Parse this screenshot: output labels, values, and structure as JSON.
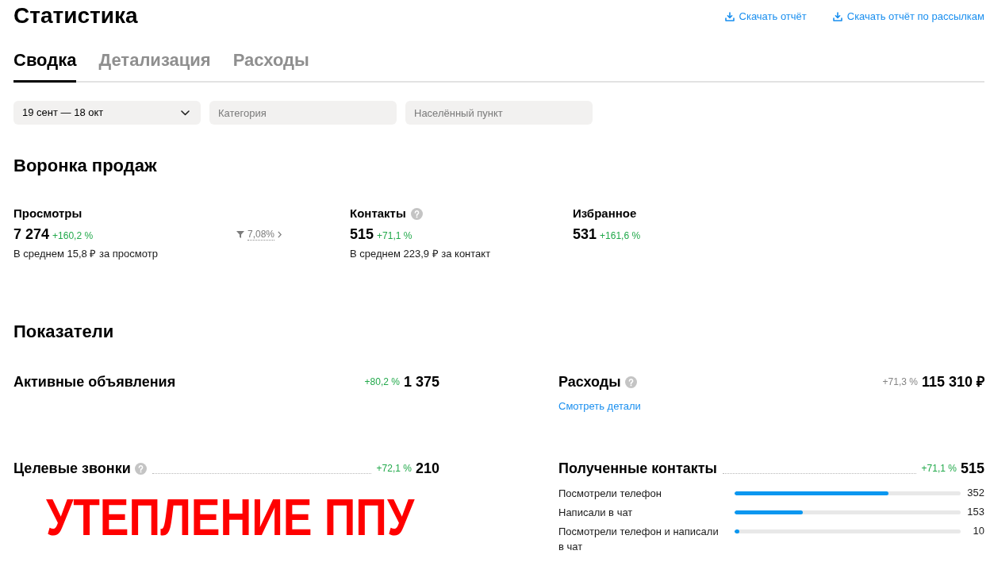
{
  "page": {
    "title": "Статистика"
  },
  "downloads": [
    {
      "label": "Скачать отчёт"
    },
    {
      "label": "Скачать отчёт по рассылкам"
    }
  ],
  "tabs": [
    {
      "label": "Сводка",
      "selected": true
    },
    {
      "label": "Детализация",
      "selected": false
    },
    {
      "label": "Расходы",
      "selected": false
    }
  ],
  "filters": [
    {
      "kind": "select",
      "value": "19 сент — 18 окт"
    },
    {
      "kind": "field",
      "placeholder": "Категория"
    },
    {
      "kind": "field",
      "placeholder": "Населённый пункт"
    }
  ],
  "funnel": {
    "title": "Воронка продаж",
    "items": [
      {
        "kind": "step",
        "label": "Просмотры",
        "help": false,
        "value": "7 274",
        "change": "+160,2 %",
        "note": "В среднем 15,8 ₽ за просмотр"
      },
      {
        "kind": "conversion",
        "value": "7,08%"
      },
      {
        "kind": "step",
        "label": "Контакты",
        "help": true,
        "value": "515",
        "change": "+71,1 %",
        "note": "В среднем 223,9 ₽ за контакт"
      },
      {
        "kind": "step",
        "label": "Избранное",
        "help": false,
        "value": "531",
        "change": "+161,6 %"
      }
    ]
  },
  "metrics": {
    "title": "Показатели",
    "items": [
      {
        "label": "Активные объявления",
        "help": false,
        "leader": false,
        "change": "+80,2 %",
        "positive": true,
        "value": "1 375"
      },
      {
        "label": "Расходы",
        "help": true,
        "leader": false,
        "change": "+71,3 %",
        "positive": false,
        "value": "115 310 ₽",
        "link": "Смотреть детали"
      },
      {
        "label": "Целевые звонки",
        "help": true,
        "leader": true,
        "change": "+72,1 %",
        "positive": true,
        "value": "210"
      },
      {
        "label": "Полученные контакты",
        "help": false,
        "leader": true,
        "change": "+71,1 %",
        "positive": true,
        "value": "515",
        "breakdown": [
          {
            "label": "Посмотрели телефон",
            "level": 0.68,
            "value": "352"
          },
          {
            "label": "Написали в чат",
            "level": 0.3,
            "value": "153"
          },
          {
            "label": "Посмотрели телефон и написали в чат",
            "level": 0.02,
            "value": "10"
          }
        ]
      }
    ]
  },
  "overlay_caption": "УТЕПЛЕНИЕ ППУ"
}
